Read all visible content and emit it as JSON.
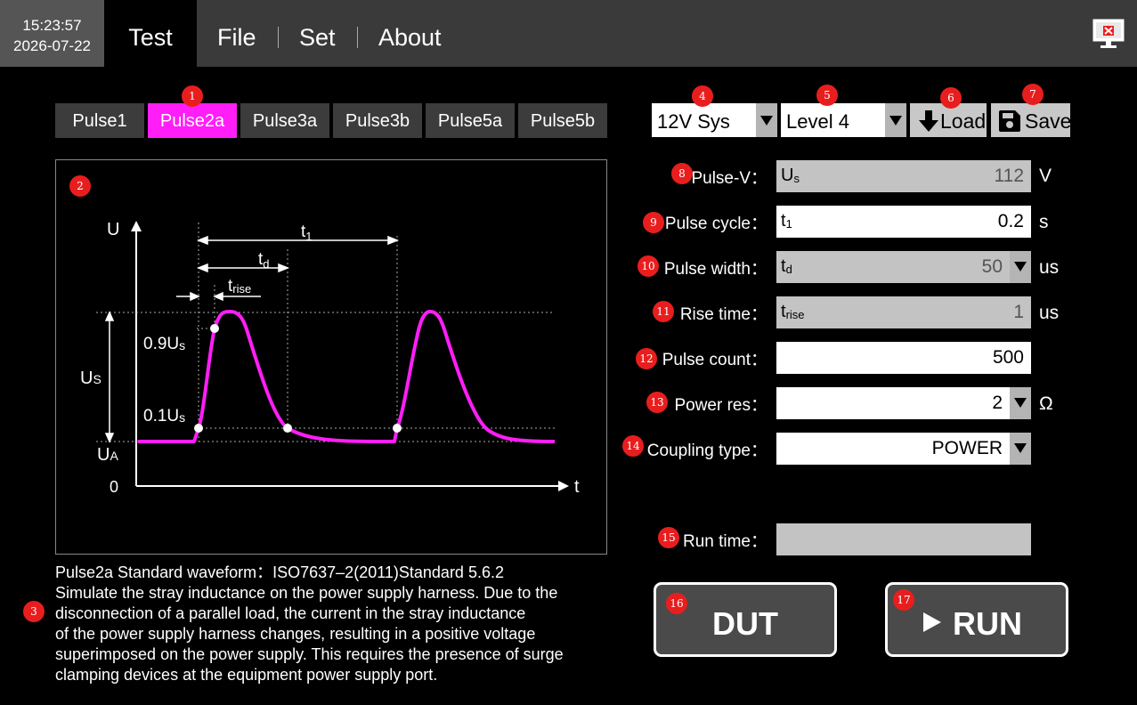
{
  "header": {
    "time": "15:23:57",
    "date": "2026-07-22",
    "tabs": [
      "Test",
      "File",
      "Set",
      "About"
    ]
  },
  "markers": [
    "1",
    "2",
    "3",
    "4",
    "5",
    "6",
    "7",
    "8",
    "9",
    "10",
    "11",
    "12",
    "13",
    "14",
    "15",
    "16",
    "17"
  ],
  "pulse_tabs": [
    "Pulse1",
    "Pulse2a",
    "Pulse3a",
    "Pulse3b",
    "Pulse5a",
    "Pulse5b"
  ],
  "active_pulse_tab": "Pulse2a",
  "diagram": {
    "axis_y": "U",
    "axis_x": "t",
    "origin": "0",
    "label_t1": "t",
    "label_t1_sub": "1",
    "label_td": "t",
    "label_td_sub": "d",
    "label_trise": "t",
    "label_trise_sub": "rise",
    "label_09": "0.9U",
    "label_09_sub": "s",
    "label_01": "0.1U",
    "label_01_sub": "s",
    "label_us": "U",
    "label_us_sub": "S",
    "label_ua": "U",
    "label_ua_sub": "A",
    "pulse_color": "#ff1ef7"
  },
  "description": [
    "Pulse2a Standard waveform：ISO7637–2(2011)Standard 5.6.2",
    "Simulate the stray inductance on the power supply harness. Due to the",
    "disconnection of a parallel load, the current in the stray inductance",
    "of the power supply harness changes, resulting in a positive voltage",
    "superimposed on the power supply. This requires the presence of surge",
    "clamping devices at the equipment power supply port."
  ],
  "controls": {
    "system": "12V Sys",
    "level": "Level 4",
    "load_label": "Load",
    "save_label": "Save"
  },
  "params": [
    {
      "label": "Pulse-V：",
      "sym": "U",
      "sub": "s",
      "value": "112",
      "unit": "V"
    },
    {
      "label": "Pulse cycle：",
      "sym": "t",
      "sub": "1",
      "value": "0.2",
      "unit": "s"
    },
    {
      "label": "Pulse width：",
      "sym": "t",
      "sub": "d",
      "value": "50",
      "unit": "us"
    },
    {
      "label": "Rise time：",
      "sym": "t",
      "sub": "rise",
      "value": "1",
      "unit": "us"
    },
    {
      "label": "Pulse count：",
      "value": "500"
    },
    {
      "label": "Power res：",
      "value": "2",
      "unit": "Ω"
    },
    {
      "label": "Coupling type：",
      "value": "POWER"
    },
    {
      "label": "Run time：",
      "value": ""
    }
  ],
  "buttons": {
    "dut": "DUT",
    "run": "RUN"
  }
}
